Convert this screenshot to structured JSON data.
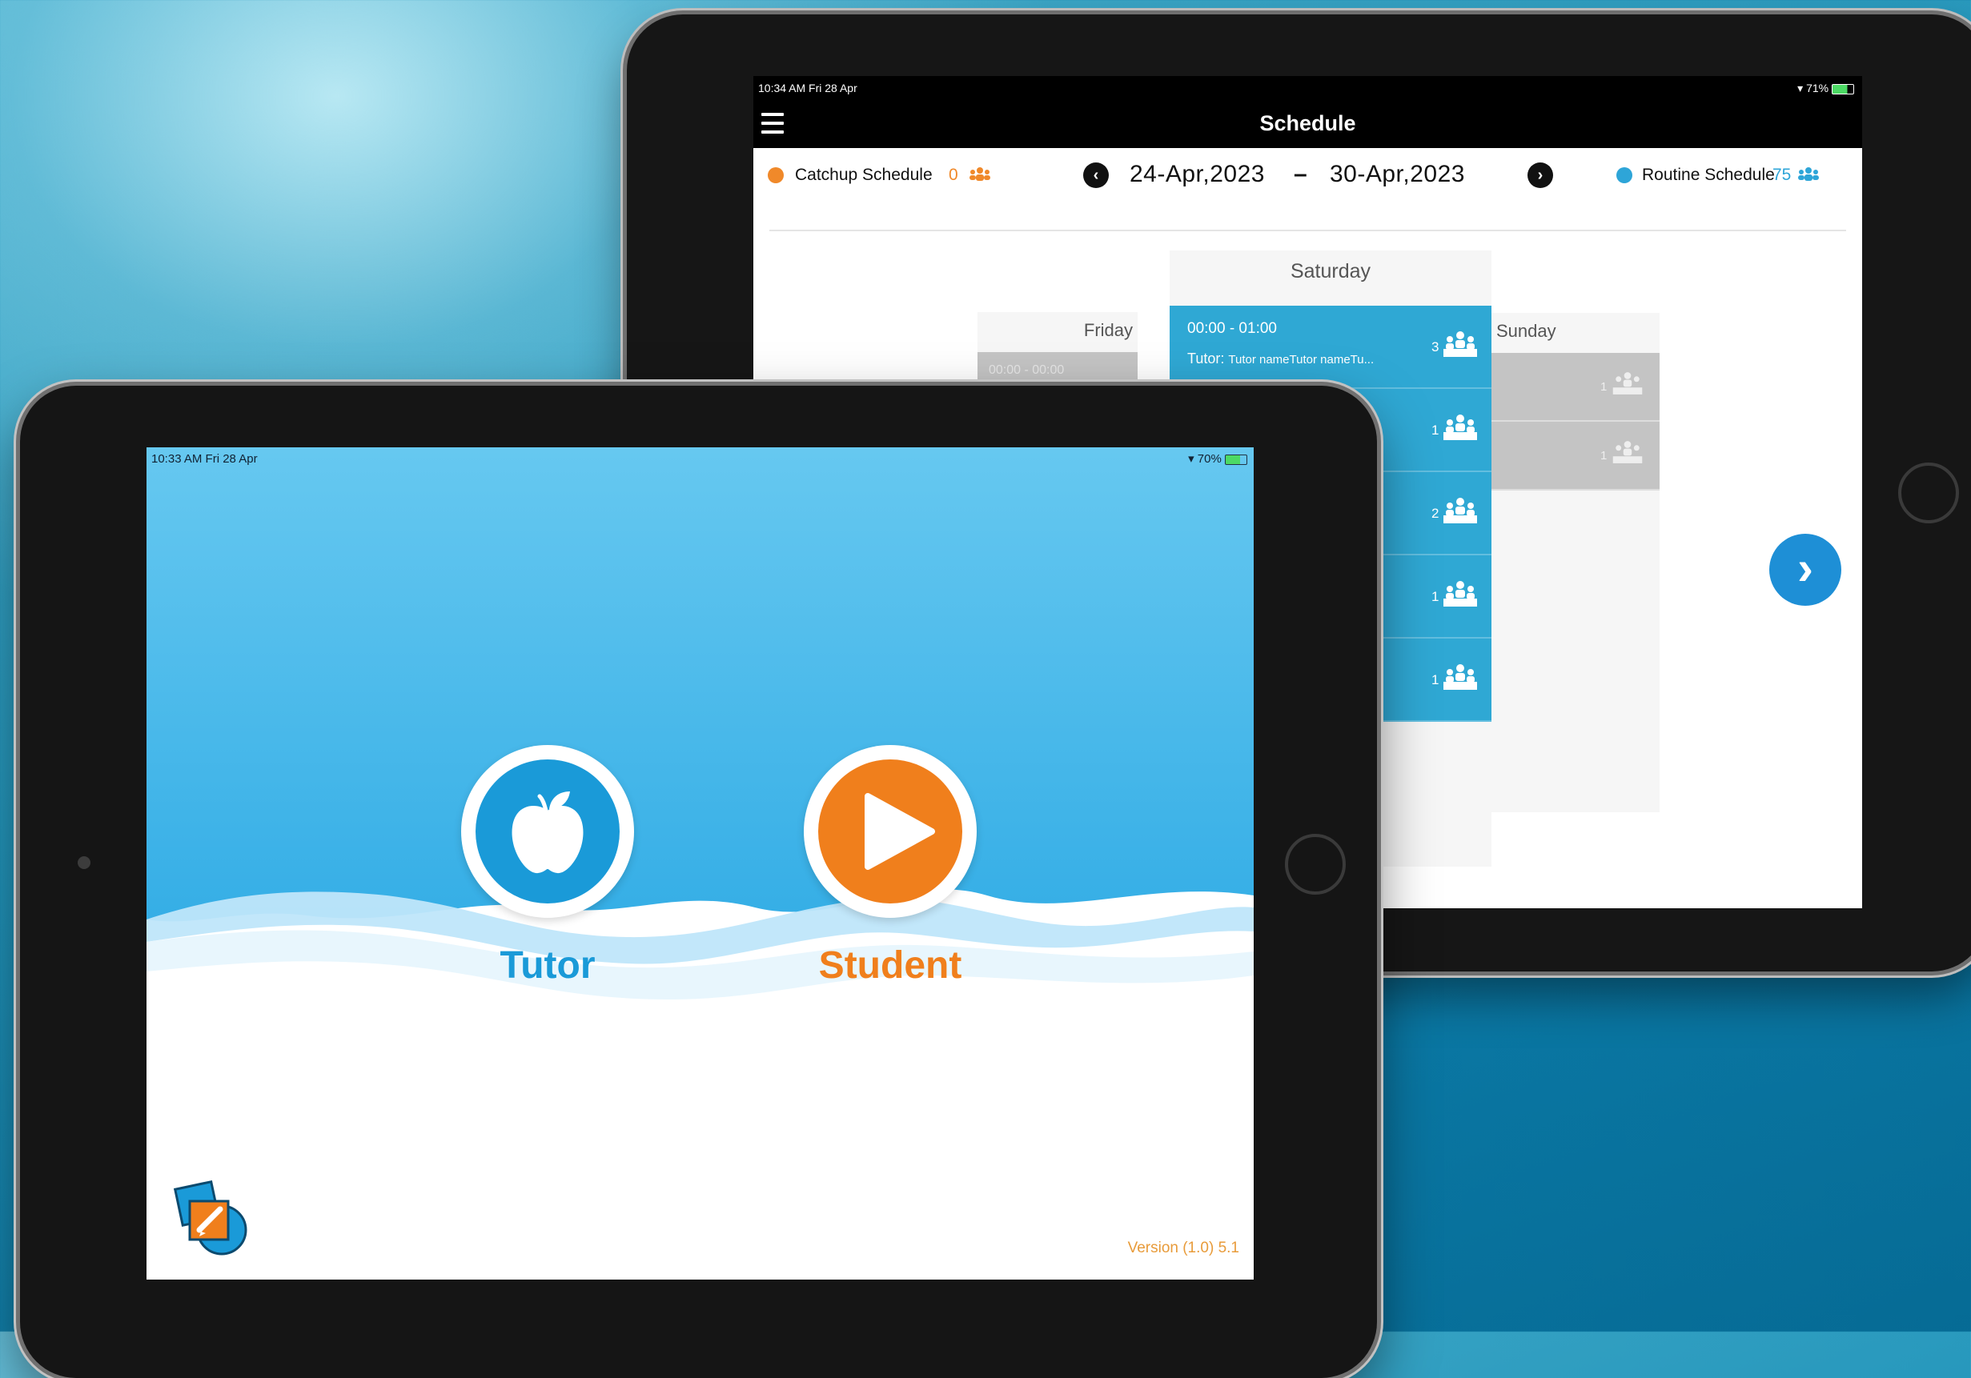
{
  "back_screen": {
    "status": {
      "time": "10:34 AM  Fri 28 Apr",
      "battery": "71%"
    },
    "header": {
      "title": "Schedule"
    },
    "legend": {
      "catchup_label": "Catchup Schedule",
      "catchup_count": "0",
      "routine_label": "Routine Schedule",
      "routine_count": "75",
      "catchup_color": "#f0892a",
      "routine_color": "#2ea5d8"
    },
    "date_range": {
      "start": "24-Apr,2023",
      "separator": "–",
      "end": "30-Apr,2023"
    },
    "days": {
      "friday": "Friday",
      "saturday": "Saturday",
      "sunday": "Sunday"
    },
    "saturday_slots": [
      {
        "time": "00:00 - 01:00",
        "tutor_label": "Tutor:",
        "tutor_name": "Tutor nameTutor nameTu...",
        "count": "3"
      },
      {
        "count": "1"
      },
      {
        "count": "2"
      },
      {
        "count": "1"
      },
      {
        "count": "1"
      }
    ],
    "friday_slot": {
      "time": "00:00 - 00:00"
    },
    "sunday_slots": [
      {
        "count": "1"
      },
      {
        "count": "1"
      }
    ]
  },
  "front_screen": {
    "status": {
      "time": "10:33 AM  Fri 28 Apr",
      "battery": "70%"
    },
    "roles": {
      "tutor": "Tutor",
      "student": "Student"
    },
    "version": "Version (1.0) 5.1",
    "colors": {
      "tutor": "#1a9ad8",
      "student": "#f07f1c",
      "sky": "#5ec3ee"
    }
  }
}
